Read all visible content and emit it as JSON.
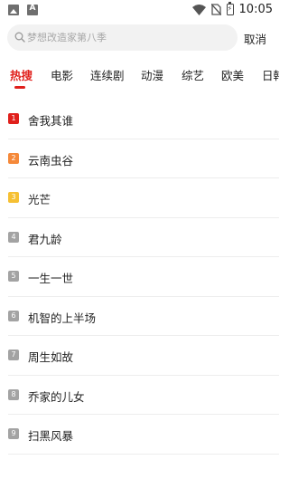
{
  "status_bar": {
    "left_icons": [
      "image-icon",
      "a-icon"
    ],
    "letter_icon_text": "A",
    "time": "10:05",
    "right_icons": [
      "wifi-icon",
      "no-sim-icon",
      "battery-charging-icon"
    ]
  },
  "search": {
    "placeholder": "梦想改造家第八季",
    "value": "",
    "icon": "search-icon",
    "cancel_label": "取消"
  },
  "tabs": [
    {
      "label": "热搜",
      "active": true
    },
    {
      "label": "电影",
      "active": false
    },
    {
      "label": "连续剧",
      "active": false
    },
    {
      "label": "动漫",
      "active": false
    },
    {
      "label": "综艺",
      "active": false
    },
    {
      "label": "欧美",
      "active": false
    },
    {
      "label": "日韩",
      "active": false
    }
  ],
  "hot_list": [
    {
      "rank": "1",
      "title": "舍我其谁"
    },
    {
      "rank": "2",
      "title": "云南虫谷"
    },
    {
      "rank": "3",
      "title": "光芒"
    },
    {
      "rank": "4",
      "title": "君九龄"
    },
    {
      "rank": "5",
      "title": "一生一世"
    },
    {
      "rank": "6",
      "title": "机智的上半场"
    },
    {
      "rank": "7",
      "title": "周生如故"
    },
    {
      "rank": "8",
      "title": "乔家的儿女"
    },
    {
      "rank": "9",
      "title": "扫黑风暴"
    }
  ],
  "colors": {
    "accent": "#e0201c",
    "rank_1": "#e0201c",
    "rank_2": "#f5893a",
    "rank_3": "#f6c033",
    "rank_default": "#a3a3a3"
  }
}
